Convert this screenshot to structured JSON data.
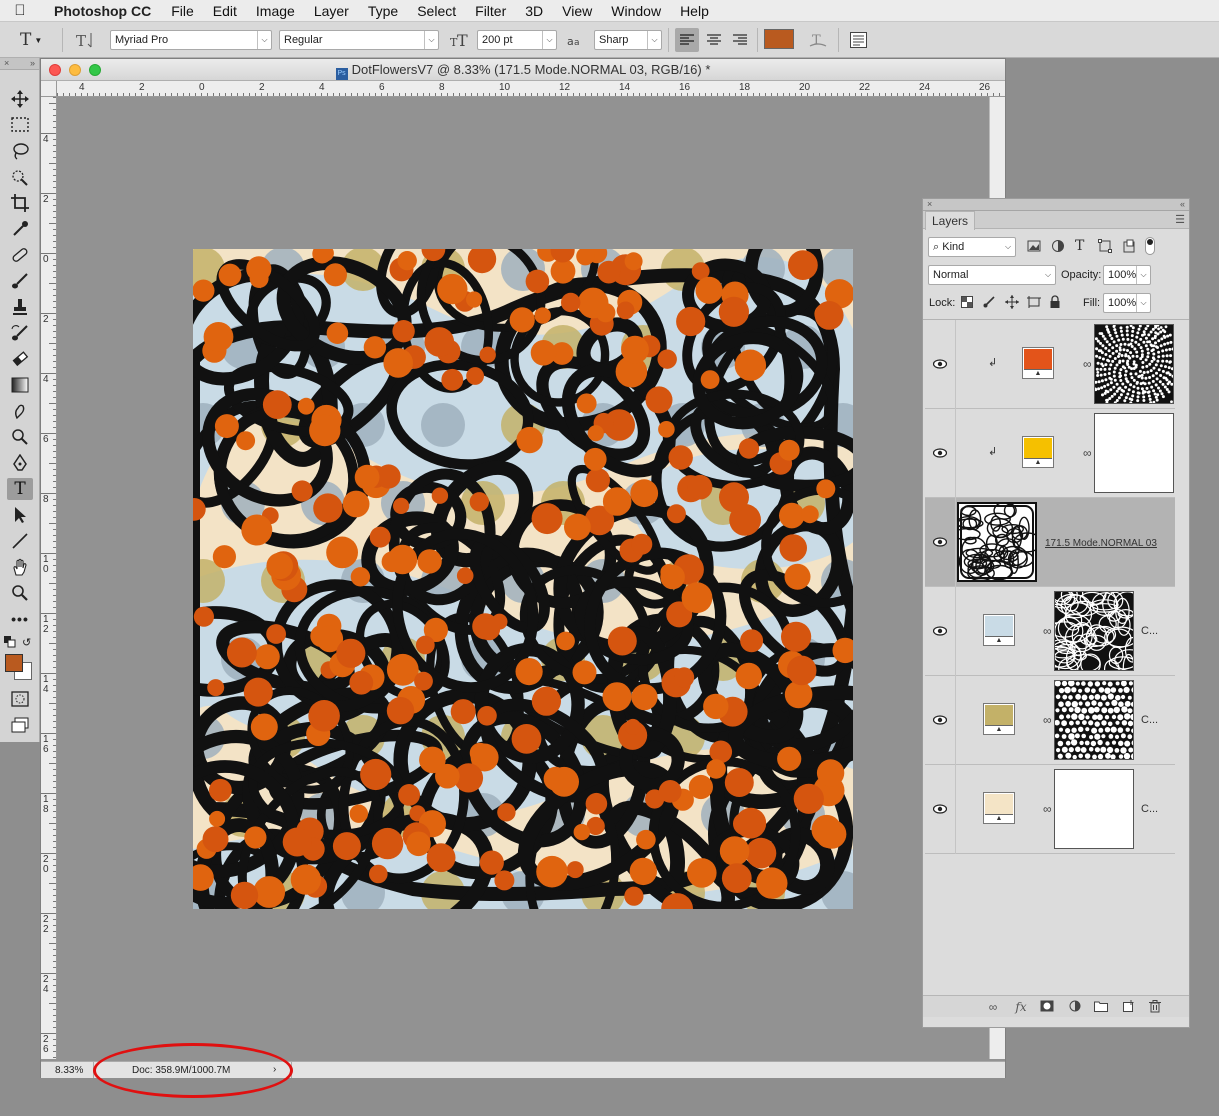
{
  "menubar": {
    "app_name": "Photoshop CC",
    "items": [
      "File",
      "Edit",
      "Image",
      "Layer",
      "Type",
      "Select",
      "Filter",
      "3D",
      "View",
      "Window",
      "Help"
    ]
  },
  "options": {
    "font_family": "Myriad Pro",
    "font_style": "Regular",
    "font_size": "200 pt",
    "aa_label": "a",
    "anti_alias": "Sharp",
    "text_color": "#b95a1f"
  },
  "document": {
    "title": "DotFlowersV7 @ 8.33% (171.5 Mode.NORMAL 03, RGB/16) *",
    "zoom": "8.33%",
    "doc_size": "Doc: 358.9M/1000.7M",
    "ruler_h": [
      "4",
      "2",
      "0",
      "2",
      "4",
      "6",
      "8",
      "10",
      "12",
      "14",
      "16",
      "18",
      "20",
      "22",
      "24",
      "26"
    ],
    "ruler_v": [
      "4",
      "2",
      "0",
      "2",
      "4",
      "6",
      "8",
      "1 0",
      "1 2",
      "1 4",
      "1 6",
      "1 8",
      "2 0",
      "2 2",
      "2 4",
      "2 6"
    ]
  },
  "tools": {
    "foreground_color": "#b95a1f",
    "background_color": "#ffffff"
  },
  "layers_panel": {
    "tab": "Layers",
    "filter_kind": "Kind",
    "blend_mode": "Normal",
    "opacity_label": "Opacity:",
    "opacity_value": "100%",
    "lock_label": "Lock:",
    "fill_label": "Fill:",
    "fill_value": "100%",
    "layers": [
      {
        "type": "fill",
        "color": "#e3541a",
        "clipped": true
      },
      {
        "type": "fill",
        "color": "#f5c000",
        "clipped": true
      },
      {
        "type": "pixel",
        "name": "171.5 Mode.NORMAL 03",
        "selected": true
      },
      {
        "type": "fill",
        "color": "#c9dbe6",
        "name": "C..."
      },
      {
        "type": "fill",
        "color": "#c3b168",
        "name": "C..."
      },
      {
        "type": "fill",
        "color": "#f4e4c6",
        "name": "C..."
      }
    ]
  }
}
